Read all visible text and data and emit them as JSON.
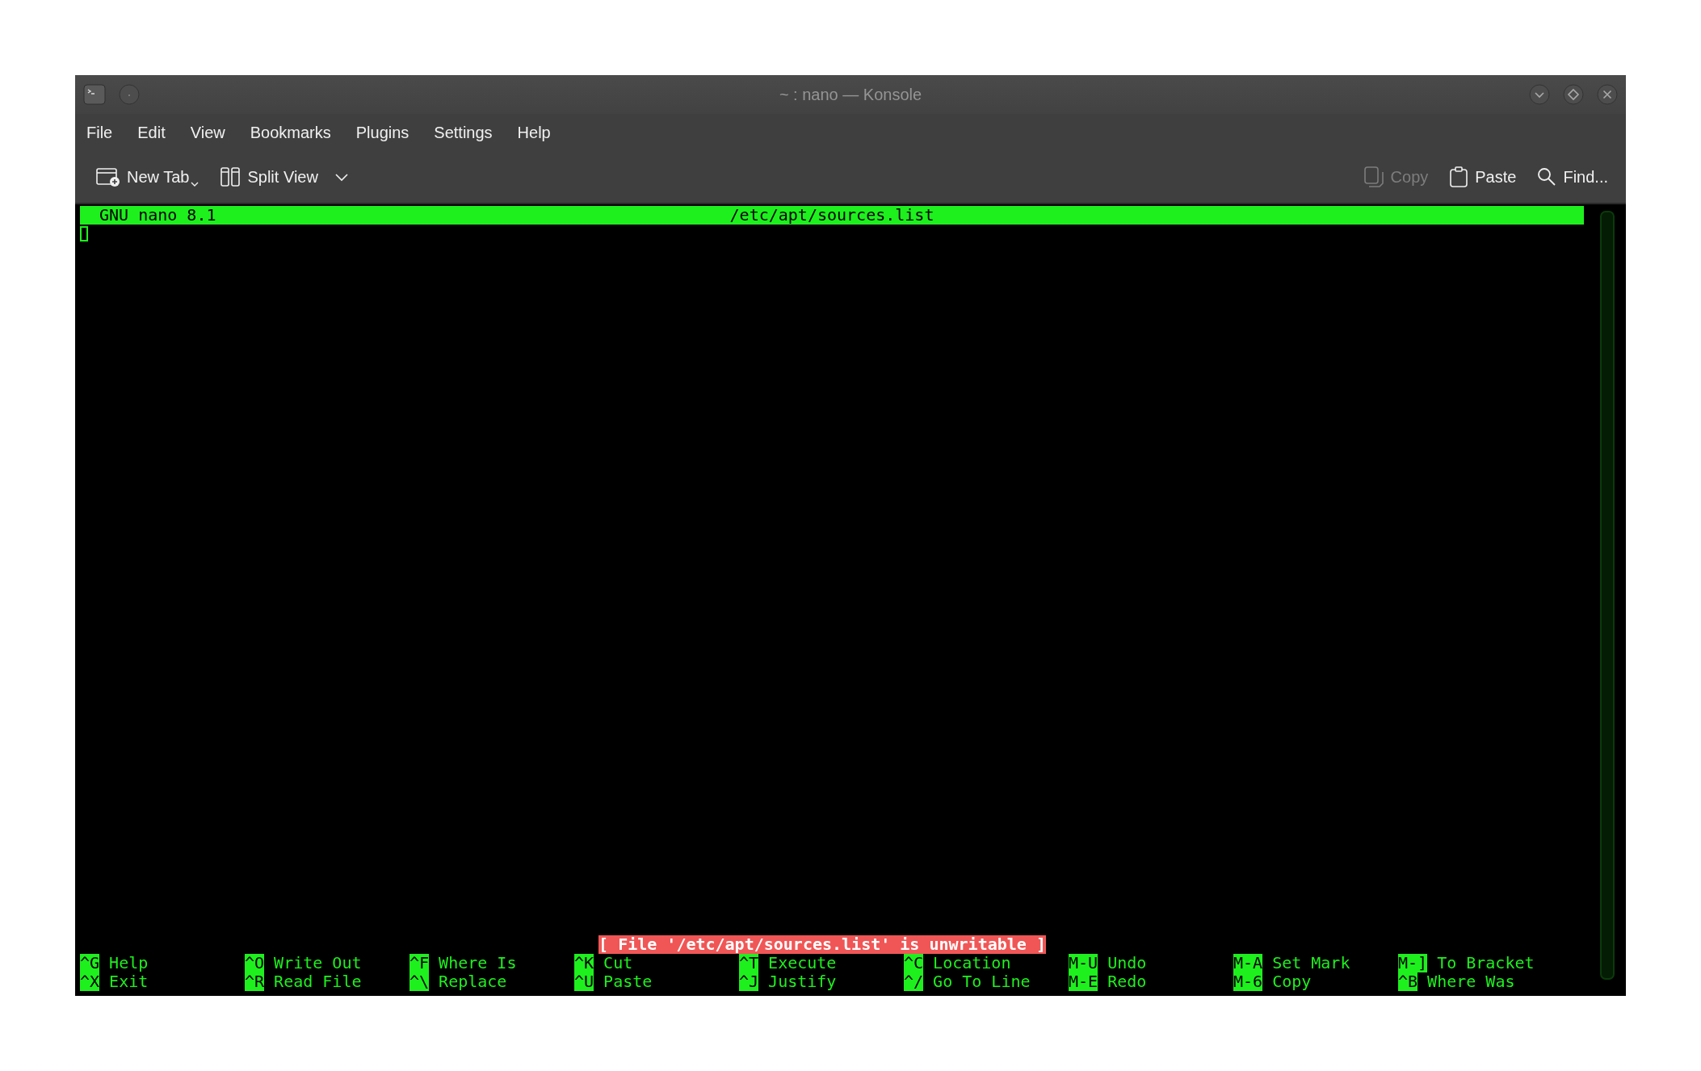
{
  "window": {
    "title": "~ : nano — Konsole"
  },
  "menu": [
    "File",
    "Edit",
    "View",
    "Bookmarks",
    "Plugins",
    "Settings",
    "Help"
  ],
  "toolbar_left": [
    {
      "label": "New Tab",
      "kind": "new-tab",
      "disabled": false
    },
    {
      "label": "Split View",
      "kind": "split-view",
      "disabled": false
    }
  ],
  "toolbar_right": [
    {
      "label": "Copy",
      "kind": "copy",
      "disabled": true
    },
    {
      "label": "Paste",
      "kind": "paste",
      "disabled": false
    },
    {
      "label": "Find...",
      "kind": "find",
      "disabled": false
    }
  ],
  "nano": {
    "version": "GNU nano 8.1",
    "filename": "/etc/apt/sources.list",
    "message": "[ File '/etc/apt/sources.list' is unwritable ]",
    "shortcut_rows": [
      [
        {
          "key": "^G",
          "label": "Help"
        },
        {
          "key": "^O",
          "label": "Write Out"
        },
        {
          "key": "^F",
          "label": "Where Is"
        },
        {
          "key": "^K",
          "label": "Cut"
        },
        {
          "key": "^T",
          "label": "Execute"
        },
        {
          "key": "^C",
          "label": "Location"
        },
        {
          "key": "M-U",
          "label": "Undo"
        },
        {
          "key": "M-A",
          "label": "Set Mark"
        },
        {
          "key": "M-]",
          "label": "To Bracket"
        }
      ],
      [
        {
          "key": "^X",
          "label": "Exit"
        },
        {
          "key": "^R",
          "label": "Read File"
        },
        {
          "key": "^\\",
          "label": "Replace"
        },
        {
          "key": "^U",
          "label": "Paste"
        },
        {
          "key": "^J",
          "label": "Justify"
        },
        {
          "key": "^/",
          "label": "Go To Line"
        },
        {
          "key": "M-E",
          "label": "Redo"
        },
        {
          "key": "M-6",
          "label": "Copy"
        },
        {
          "key": "^B",
          "label": "Where Was"
        }
      ]
    ]
  }
}
